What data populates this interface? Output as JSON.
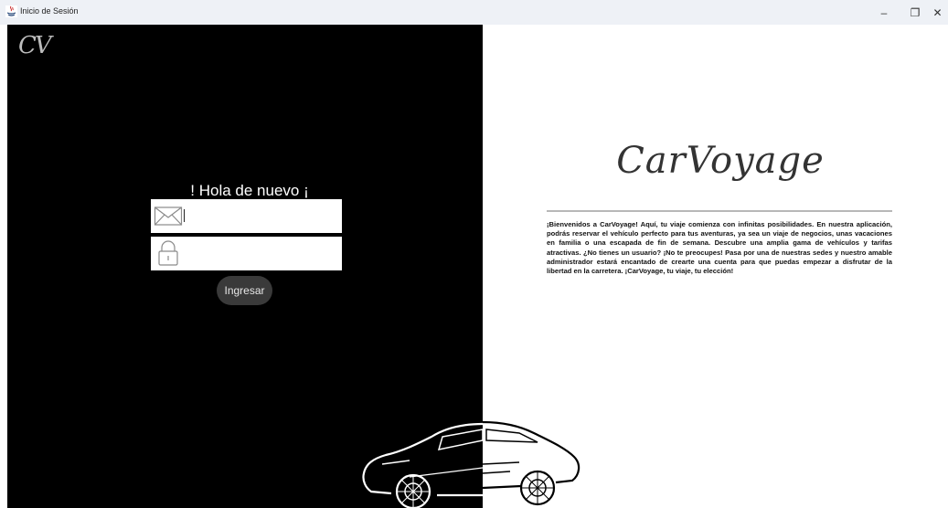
{
  "window": {
    "title": "Inicio de Sesión",
    "controls": {
      "minimize": "–",
      "maximize": "❐",
      "close": "✕"
    }
  },
  "login_panel": {
    "logo": "CV",
    "greeting": "! Hola de nuevo ¡",
    "email": {
      "icon": "envelope-icon",
      "value": "",
      "placeholder": ""
    },
    "password": {
      "icon": "padlock-icon",
      "value": "",
      "placeholder": ""
    },
    "submit_label": "Ingresar"
  },
  "info_panel": {
    "brand": "CarVoyage",
    "welcome_text": "¡Bienvenidos a CarVoyage! Aquí, tu viaje comienza con infinitas posibilidades. En nuestra aplicación, podrás reservar el vehículo perfecto para tus aventuras, ya sea un viaje de negocios, unas vacaciones en familia o una escapada de fin de semana. Descubre una amplia gama de vehículos y tarifas atractivas. ¿No tienes un usuario? ¡No te preocupes! Pasa por una de nuestras sedes y nuestro amable administrador estará encantado de crearte una cuenta para que puedas empezar a disfrutar de la libertad en la carretera. ¡CarVoyage, tu viaje, tu elección!"
  },
  "colors": {
    "left_bg": "#000000",
    "right_bg": "#ffffff",
    "button_bg": "#3a3a3a"
  }
}
